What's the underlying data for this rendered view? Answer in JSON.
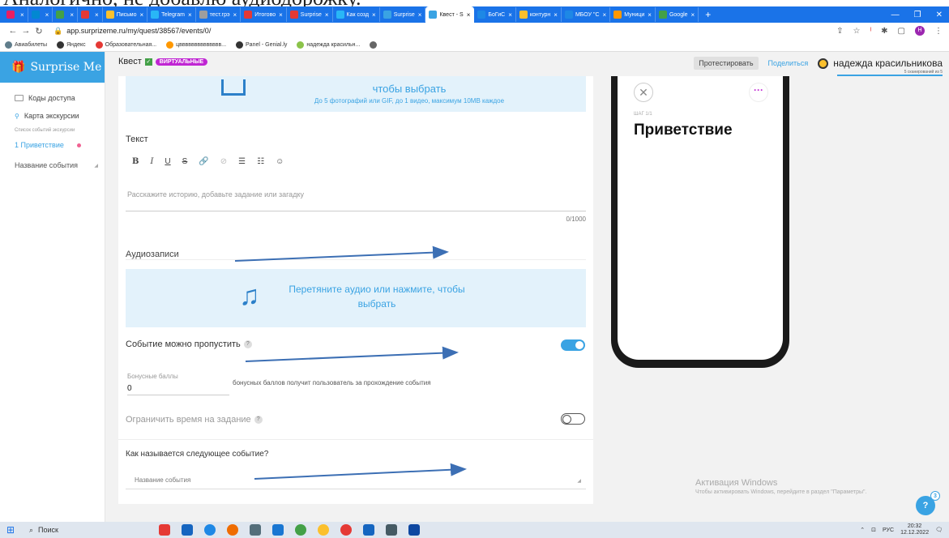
{
  "caption": "Аналогично, не добавлю аудиодорожку.",
  "browser": {
    "tabs": [
      {
        "label": "",
        "color": "#e91e63"
      },
      {
        "label": "",
        "color": "#0288d1"
      },
      {
        "label": "",
        "color": "#43a047"
      },
      {
        "label": "",
        "color": "#e53935"
      },
      {
        "label": "Письмо",
        "color": "#fbc02d"
      },
      {
        "label": "Telegram",
        "color": "#29b6f6"
      },
      {
        "label": "тест.грэ",
        "color": "#9e9e9e"
      },
      {
        "label": "Итогово",
        "color": "#e53935"
      },
      {
        "label": "Surprise",
        "color": "#e53935"
      },
      {
        "label": "Как созд",
        "color": "#29b6f6"
      },
      {
        "label": "Surprise",
        "color": "#3aa3e3"
      },
      {
        "label": "Квест - S",
        "color": "#3aa3e3",
        "active": true
      },
      {
        "label": "БоГиС",
        "color": "#1e88e5"
      },
      {
        "label": "контурн",
        "color": "#fbc02d"
      },
      {
        "label": "МБОУ \"С",
        "color": "#1e88e5"
      },
      {
        "label": "Муници",
        "color": "#ff9800"
      },
      {
        "label": "Google",
        "color": "#43a047"
      }
    ],
    "url": "app.surprizeme.ru/my/quest/38567/events/0/",
    "bookmarks": [
      {
        "label": "Авиабилеты",
        "color": "#607d8b"
      },
      {
        "label": "Яндекс",
        "color": "#333333"
      },
      {
        "label": "Образовательная...",
        "color": "#e53935"
      },
      {
        "label": "цвввввввввввввв...",
        "color": "#ff9800"
      },
      {
        "label": "Panel - Genial.ly",
        "color": "#333333"
      },
      {
        "label": "надежда красильн...",
        "color": "#8bc34a"
      },
      {
        "label": "",
        "color": "#666666"
      }
    ],
    "profile_initial": "Н"
  },
  "sidebar": {
    "brand": "Surprise Me",
    "items": [
      {
        "label": "Коды доступа"
      },
      {
        "label": "Карта экскурсии"
      }
    ],
    "section_title": "Список событий экскурсии",
    "active_event": "1 Приветствие",
    "event_name": "Название события"
  },
  "topbar": {
    "quest_label": "Квест",
    "badge": "ВИРТУАЛЬНЫЕ",
    "test_button": "Протестировать",
    "share_button": "Поделиться",
    "user_name": "надежда красильникова",
    "scan_note": "5 сканирований из 5"
  },
  "editor": {
    "photo_upload_title": "чтобы выбрать",
    "photo_upload_sub": "До 5 фотографий или GIF, до 1 видео, максимум 10MB каждое",
    "text_label": "Текст",
    "toolbar": [
      "B",
      "I",
      "U",
      "S",
      "🔗",
      "⊘",
      "☰",
      "☷",
      "☺"
    ],
    "text_placeholder": "Расскажите историю, добавьте задание или загадку",
    "counter": "0/1000",
    "audio_label": "Аудиозаписи",
    "audio_upload_line1": "Перетяните аудио или нажмите, чтобы",
    "audio_upload_line2": "выбрать",
    "skip_label": "Событие можно пропустить",
    "skip_on": true,
    "bonus_label": "Бонусные баллы",
    "bonus_value": "0",
    "bonus_desc": "бонусных баллов получит пользователь за прохождение события",
    "limit_label": "Ограничить время на задание",
    "limit_on": false,
    "next_event_question": "Как называется следующее событие?",
    "next_event_placeholder": "Название события",
    "help_glyph": "?"
  },
  "preview": {
    "step_label": "ШАГ 1/1",
    "title": "Приветствие"
  },
  "windows": {
    "activation_title": "Активация Windows",
    "activation_sub": "Чтобы активировать Windows, перейдите в раздел \"Параметры\".",
    "search_label": "Поиск",
    "lang": "РУС",
    "time": "20:32",
    "date": "12.12.2022",
    "help_count": "3"
  },
  "colors": {
    "accent": "#3aa3e3",
    "badge": "#c026d3",
    "arrow": "#3c6fb4"
  }
}
